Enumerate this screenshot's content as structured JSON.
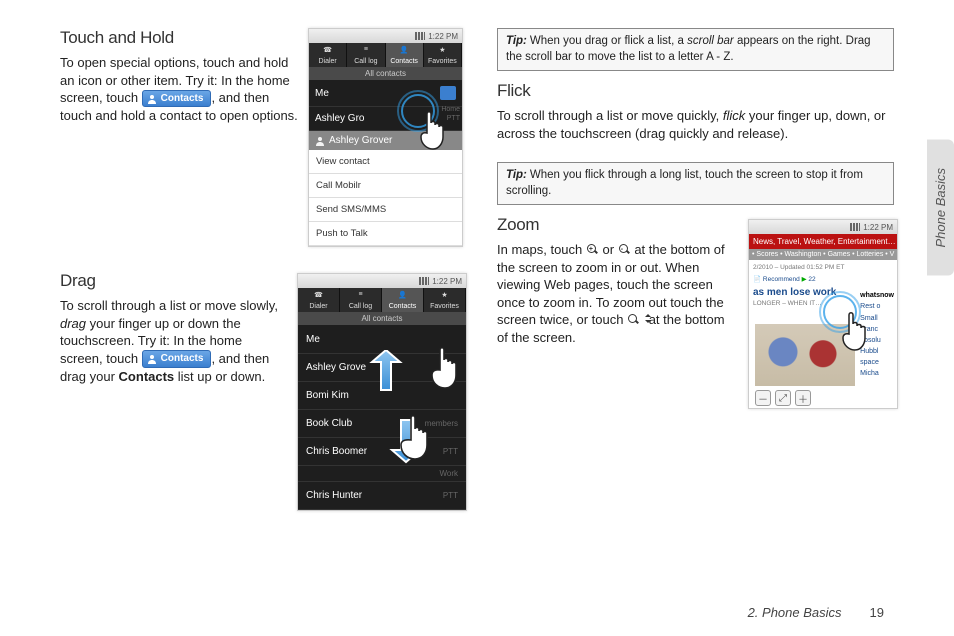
{
  "sideTab": "Phone Basics",
  "footer": {
    "chapter": "2. Phone Basics",
    "page": "19"
  },
  "left": {
    "touchHold": {
      "heading": "Touch and Hold",
      "p1a": "To open special options, touch and hold an icon or other item. Try it: In the home screen, touch ",
      "pillLabel": "Contacts",
      "p1b": ", and then touch and hold a contact to open options."
    },
    "phone1": {
      "time": "1:22 PM",
      "tabs": [
        "Dialer",
        "Call log",
        "Contacts",
        "Favorites"
      ],
      "activeIndex": 2,
      "allContacts": "All contacts",
      "rows": [
        "Me",
        "Ashley Gro"
      ],
      "ctxHeader": "Ashley Grover",
      "ctxItems": [
        "View contact",
        "Call Mobilr",
        "Send SMS/MMS",
        "Push to Talk"
      ],
      "sideLabels": [
        "Home",
        "PTT"
      ]
    },
    "drag": {
      "heading": "Drag",
      "p1a": "To scroll through a list or move slowly, ",
      "italic": "drag",
      "p1b": " your finger up or down the touchscreen. Try it: In the home screen, touch ",
      "pillLabel": "Contacts",
      "p1c": ", and then drag your ",
      "bold": "Contacts",
      "p1d": " list up or down."
    },
    "phone2": {
      "time": "1:22 PM",
      "tabs": [
        "Dialer",
        "Call log",
        "Contacts",
        "Favorites"
      ],
      "activeIndex": 2,
      "allContacts": "All contacts",
      "rows": [
        {
          "n": "Me",
          "s": ""
        },
        {
          "n": "Ashley Grove",
          "s": ""
        },
        {
          "n": "Bomi Kim",
          "s": ""
        },
        {
          "n": "Book Club",
          "s": "members"
        },
        {
          "n": "Chris Boomer",
          "s": "PTT"
        },
        {
          "n": "",
          "s": "Work"
        },
        {
          "n": "Chris Hunter",
          "s": "PTT"
        }
      ]
    }
  },
  "right": {
    "tip1": {
      "label": "Tip:",
      "body1": "When you drag or flick a list, a ",
      "ital": "scroll bar",
      "body2": " appears on the right. Drag the scroll bar to move the list to a letter A - Z."
    },
    "flick": {
      "heading": "Flick",
      "p1a": "To scroll through a list or move quickly, ",
      "italic": "flick",
      "p1b": " your finger up, down, or across the touchscreen (drag quickly and release)."
    },
    "tip2": {
      "label": "Tip:",
      "body": "When you flick through a long list, touch the screen to stop it from scrolling."
    },
    "zoom": {
      "heading": "Zoom",
      "p1a": "In maps, touch ",
      "p1b": " or ",
      "p1c": " at the bottom of the screen to zoom in or out. When viewing Web pages, touch the screen once to zoom in. To zoom out touch the screen twice, or touch ",
      "p1d": " at the bottom of the screen."
    },
    "phone3": {
      "time": "1:22 PM",
      "redbar": "News, Travel, Weather, Entertainment…",
      "graybar": "• Scores • Washington • Games • Lotteries • V",
      "dateline": "2/2010 – Updated 01:52 PM ET",
      "rec": "Recommend",
      "headline": "as men lose work",
      "sub": "LONGER – WHEN IT…",
      "sidelinks": [
        "Rest o",
        "Small",
        "Franc",
        "absolu",
        "Hubbl",
        "space",
        "Micha"
      ]
    }
  }
}
